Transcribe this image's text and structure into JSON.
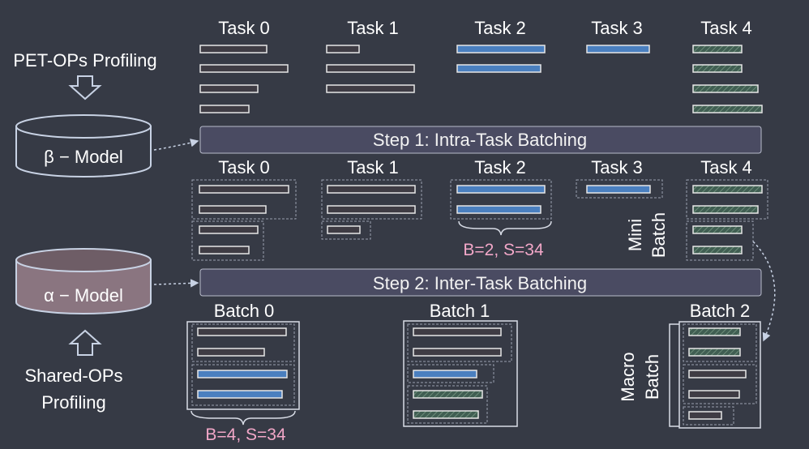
{
  "colors": {
    "background": "#363a45",
    "plain_bar": "#3f3c44",
    "blue_bar": "#4a7fbf",
    "hatch_bar": "#405e52",
    "pink_text": "#f2a7c8",
    "step_band": "#4a4b62"
  },
  "left": {
    "pet_profiling": "PET-OPs  Profiling",
    "beta_model": "β − Model",
    "alpha_model": "α − Model",
    "shared_profiling_line1": "Shared-OPs",
    "shared_profiling_line2": "Profiling"
  },
  "tasks_top": [
    "Task 0",
    "Task 1",
    "Task 2",
    "Task 3",
    "Task 4"
  ],
  "tasks_mid": [
    "Task 0",
    "Task 1",
    "Task 2",
    "Task 3",
    "Task 4"
  ],
  "steps": {
    "step1": "Step 1: Intra-Task Batching",
    "step2": "Step 2: Inter-Task Batching"
  },
  "annotations": {
    "mini_1": "Mini",
    "mini_2": "Batch",
    "macro_1": "Macro",
    "macro_2": "Batch",
    "b2s34": "B=2,  S=34",
    "b4s34": "B=4,  S=34"
  },
  "batches": [
    "Batch  0",
    "Batch  1",
    "Batch  2"
  ]
}
